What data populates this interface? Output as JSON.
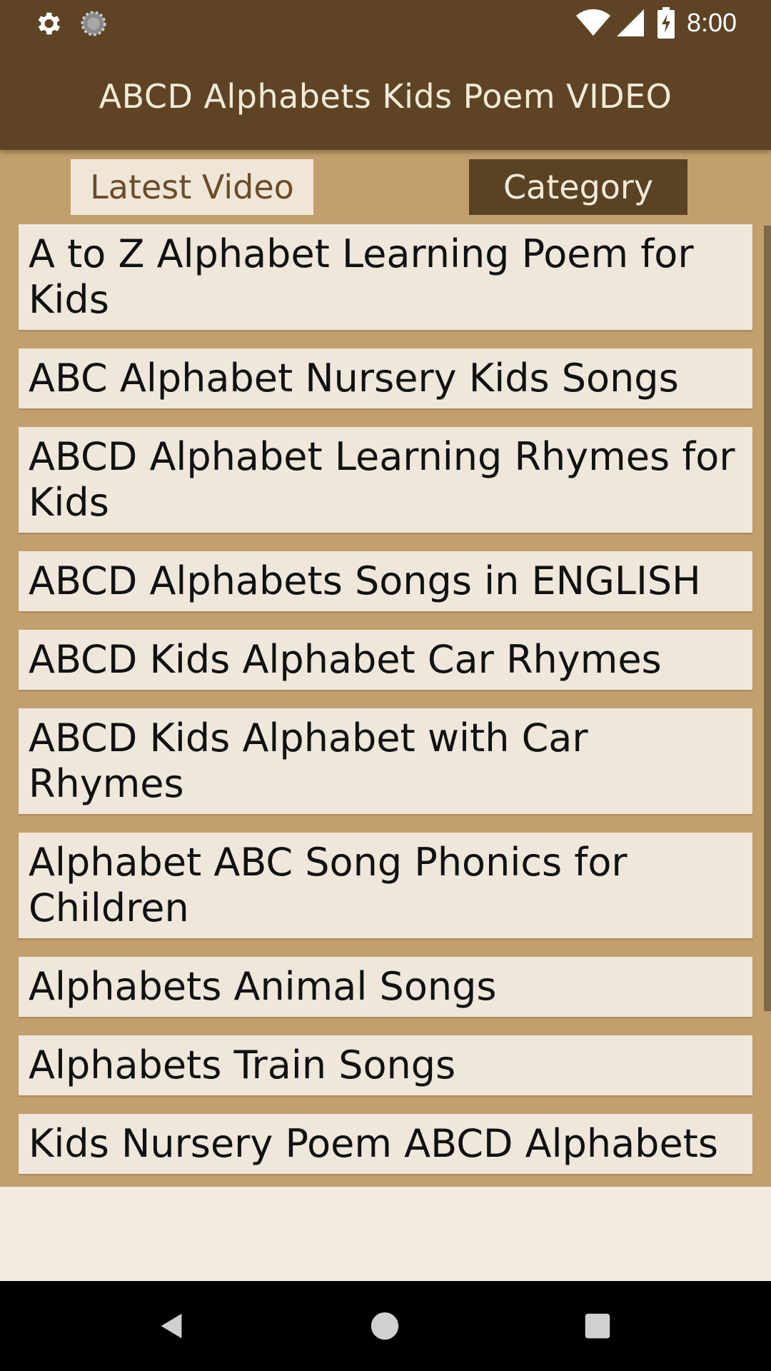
{
  "status_bar": {
    "time": "8:00",
    "icons": [
      "gear-icon",
      "sync-icon",
      "wifi-icon",
      "signal-icon",
      "battery-charging-icon"
    ]
  },
  "app_bar": {
    "title": "ABCD Alphabets Kids Poem VIDEO"
  },
  "tabs": [
    {
      "label": "Latest Video",
      "selected": false
    },
    {
      "label": "Category",
      "selected": true
    }
  ],
  "list": {
    "items": [
      {
        "label": "A to Z Alphabet Learning Poem for Kids"
      },
      {
        "label": "ABC Alphabet Nursery Kids Songs"
      },
      {
        "label": "ABCD Alphabet Learning Rhymes for Kids"
      },
      {
        "label": "ABCD Alphabets Songs in ENGLISH"
      },
      {
        "label": "ABCD Kids Alphabet Car Rhymes"
      },
      {
        "label": "ABCD Kids Alphabet with Car Rhymes"
      },
      {
        "label": "Alphabet ABC Song Phonics for Children"
      },
      {
        "label": "Alphabets Animal Songs"
      },
      {
        "label": "Alphabets Train Songs"
      },
      {
        "label": "Kids Nursery Poem ABCD Alphabets"
      }
    ]
  },
  "nav_bar": {
    "icons": [
      "back-icon",
      "home-icon",
      "recent-apps-icon"
    ]
  },
  "colors": {
    "toolbar": "#5e4425",
    "background": "#c29f6d",
    "card": "#efe7dc",
    "tab_selected": "#5a4225",
    "tab_unselected": "#f0e6d8"
  }
}
